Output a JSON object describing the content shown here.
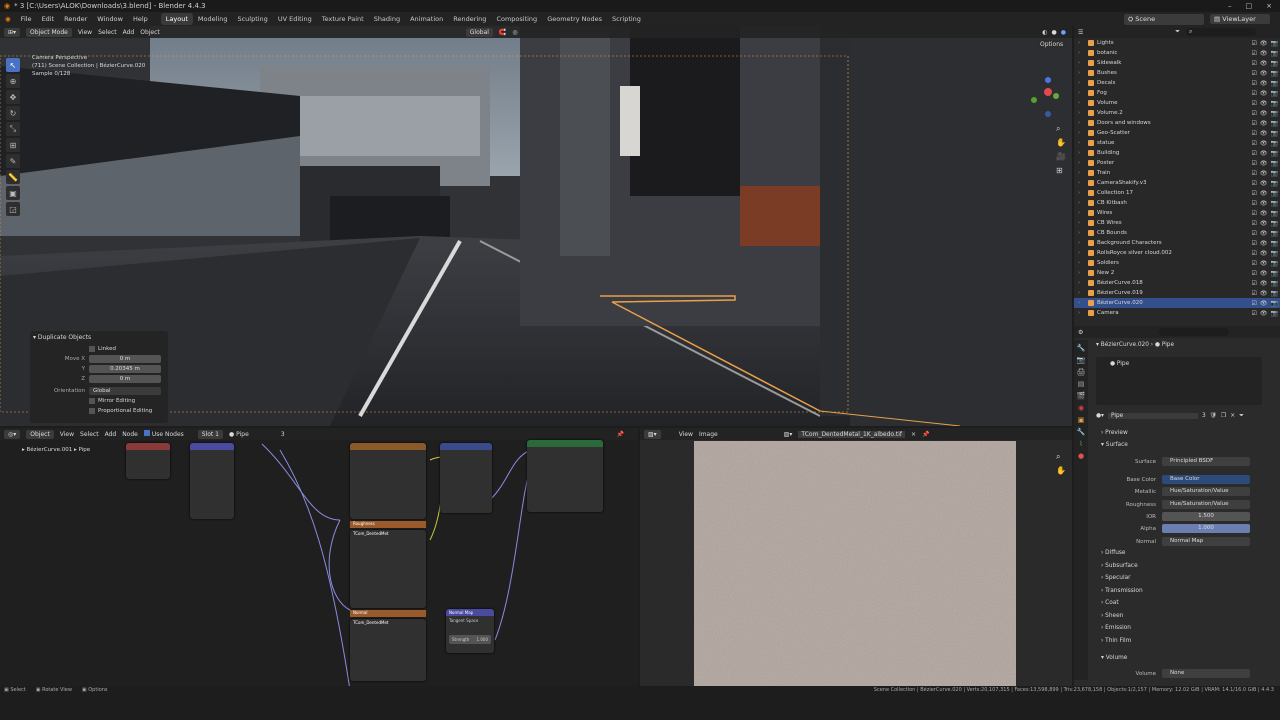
{
  "window": {
    "title": "* 3 [C:\\Users\\ALOK\\Downloads\\3.blend] - Blender 4.4.3",
    "min": "–",
    "max": "□",
    "close": "×"
  },
  "menubar": {
    "menus": [
      "File",
      "Edit",
      "Render",
      "Window",
      "Help"
    ],
    "workspaces": [
      "Layout",
      "Modeling",
      "Sculpting",
      "UV Editing",
      "Texture Paint",
      "Shading",
      "Animation",
      "Rendering",
      "Compositing",
      "Geometry Nodes",
      "Scripting"
    ],
    "active_workspace": "Layout",
    "scene_label": "Scene",
    "viewlayer_label": "ViewLayer"
  },
  "viewport": {
    "mode": "Object Mode",
    "menus": [
      "View",
      "Select",
      "Add",
      "Object"
    ],
    "transform": "Global",
    "options": "Options",
    "overlay_lines": [
      "Camera Perspective",
      "(711) Scene Collection | BézierCurve.020",
      "Sample 0/128"
    ]
  },
  "dup_panel": {
    "title": "Duplicate Objects",
    "linked": "Linked",
    "move_x_label": "Move X",
    "move_x": "0 m",
    "y_label": "Y",
    "y": "0.20345 m",
    "z_label": "Z",
    "z": "0 m",
    "orientation_label": "Orientation",
    "orientation": "Global",
    "mirror": "Mirror Editing",
    "proportional": "Proportional Editing"
  },
  "outliner": {
    "search_placeholder": "",
    "items": [
      {
        "name": "Lights",
        "sel": false
      },
      {
        "name": "botanic",
        "sel": false
      },
      {
        "name": "Sidewalk",
        "sel": false
      },
      {
        "name": "Bushes",
        "sel": false
      },
      {
        "name": "Decals",
        "sel": false
      },
      {
        "name": "Fog",
        "sel": false
      },
      {
        "name": "Volume",
        "sel": false
      },
      {
        "name": "Volume.2",
        "sel": false
      },
      {
        "name": "Doors and windows",
        "sel": false
      },
      {
        "name": "Geo-Scatter",
        "sel": false
      },
      {
        "name": "statue",
        "sel": false
      },
      {
        "name": "Building",
        "sel": false
      },
      {
        "name": "Poster",
        "sel": false
      },
      {
        "name": "Train",
        "sel": false
      },
      {
        "name": "CameraShakify.v3",
        "sel": false
      },
      {
        "name": "Collection 17",
        "sel": false
      },
      {
        "name": "CB Kitbash",
        "sel": false
      },
      {
        "name": "Wires",
        "sel": false
      },
      {
        "name": "CB Wires",
        "sel": false
      },
      {
        "name": "CB Bounds",
        "sel": false
      },
      {
        "name": "Background Characters",
        "sel": false
      },
      {
        "name": "RollsRoyce silver cloud.002",
        "sel": false
      },
      {
        "name": "Soldiers",
        "sel": false
      },
      {
        "name": "New 2",
        "sel": false
      },
      {
        "name": "BézierCurve.018",
        "sel": false
      },
      {
        "name": "BézierCurve.019",
        "sel": false
      },
      {
        "name": "BézierCurve.020",
        "sel": true
      },
      {
        "name": "Camera",
        "sel": false
      }
    ]
  },
  "props": {
    "breadcrumb_obj": "BézierCurve.020",
    "breadcrumb_mat": "Pipe",
    "material_slot": "Pipe",
    "material_name": "Pipe",
    "users": "3",
    "preview": "Preview",
    "surface_section": "Surface",
    "surface_label": "Surface",
    "surface_val": "Principled BSDF",
    "base_color_label": "Base Color",
    "base_color_val": "Base Color",
    "metallic_label": "Metallic",
    "metallic_val": "Hue/Saturation/Value",
    "roughness_label": "Roughness",
    "roughness_val": "Hue/Saturation/Value",
    "ior_label": "IOR",
    "ior_val": "1.500",
    "alpha_label": "Alpha",
    "alpha_val": "1.000",
    "normal_label": "Normal",
    "normal_val": "Normal Map",
    "subsections": [
      "Diffuse",
      "Subsurface",
      "Specular",
      "Transmission",
      "Coat",
      "Sheen",
      "Emission",
      "Thin Film"
    ],
    "volume_section": "Volume",
    "volume_label": "Volume",
    "volume_val": "None"
  },
  "nodeeditor": {
    "type": "Object",
    "menus": [
      "View",
      "Select",
      "Add",
      "Node"
    ],
    "use_nodes": "Use Nodes",
    "slot": "Slot 1",
    "material": "Pipe",
    "users": "3",
    "breadcrumb_obj": "BézierCurve.001",
    "breadcrumb_mat": "Pipe",
    "frame_labels": [
      "Roughness",
      "Normal"
    ],
    "tex_name": "TCom_DentedMet",
    "normal_map": "Normal Map",
    "tangent": "Tangent Space",
    "strength_label": "Strength",
    "strength": "1.000"
  },
  "imageeditor": {
    "menus": [
      "View",
      "Image"
    ],
    "image_name": "TCom_DentedMetal_1K_albedo.tif"
  },
  "status": {
    "left": [
      "Select",
      "Rotate View",
      "Options"
    ],
    "right": "Scene Collection | BézierCurve.020 | Verts:20,107,315 | Faces:13,598,899 | Tris:23,678,158 | Objects:1/2,157 | Memory: 12.02 GiB | VRAM: 14.1/16.0 GiB | 4.4.3"
  }
}
